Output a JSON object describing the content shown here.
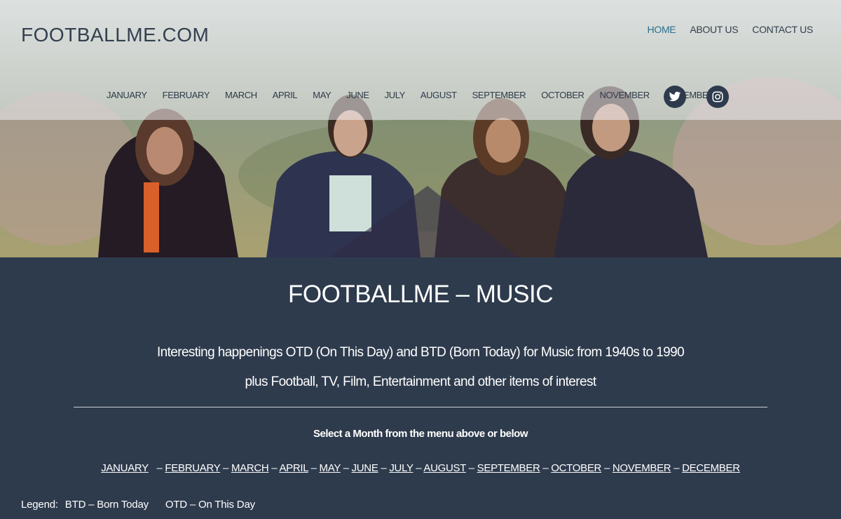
{
  "site": {
    "title": "FOOTBALLME.COM"
  },
  "top_nav": [
    {
      "label": "HOME",
      "active": true
    },
    {
      "label": "ABOUT US",
      "active": false
    },
    {
      "label": "CONTACT US",
      "active": false
    }
  ],
  "month_nav": [
    "JANUARY",
    "FEBRUARY",
    "MARCH",
    "APRIL",
    "MAY",
    "JUNE",
    "JULY",
    "AUGUST",
    "SEPTEMBER",
    "OCTOBER",
    "NOVEMBER",
    "DECEMBER"
  ],
  "social": {
    "twitter_icon": "twitter-icon",
    "instagram_icon": "instagram-icon"
  },
  "main": {
    "heading": "FOOTBALLME – MUSIC",
    "intro_line1": "Interesting happenings OTD (On This Day) and BTD (Born Today) for Music from 1940s to 1990",
    "intro_line2": "plus Football, TV, Film, Entertainment and other items of interest",
    "select_text": "Select a Month from the menu above or below",
    "month_links": [
      "JANUARY",
      "FEBRUARY",
      "MARCH",
      "APRIL",
      "MAY",
      "JUNE",
      "JULY",
      "AUGUST",
      "SEPTEMBER",
      "OCTOBER",
      "NOVEMBER",
      "DECEMBER"
    ],
    "month_separator": "–",
    "legend_label": "Legend:",
    "legend_btd": "BTD – Born Today",
    "legend_otd": "OTD – On This Day"
  },
  "colors": {
    "background": "#2e3b4d",
    "accent": "#2c6f8c",
    "text_light": "#ffffff",
    "nav_text": "#33404f"
  }
}
